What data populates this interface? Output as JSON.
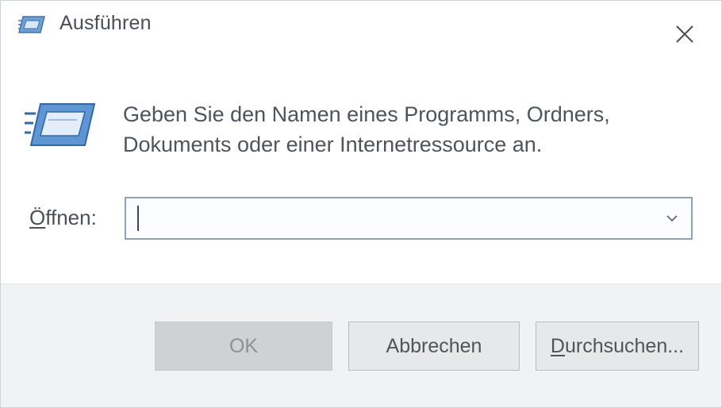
{
  "dialog": {
    "title": "Ausführen",
    "close_label": "✕",
    "description_line1": "Geben Sie den Namen eines Programms, Ordners,",
    "description_line2": "Dokuments oder einer Internetressource an.",
    "open_label_mnemonic": "Ö",
    "open_label_rest": "ffnen:",
    "open_input_value": "",
    "buttons": {
      "ok": "OK",
      "cancel": "Abbrechen",
      "browse_mnemonic": "D",
      "browse_rest": "urchsuchen..."
    }
  },
  "icons": {
    "title": "run-icon",
    "main": "run-icon",
    "close": "close-icon",
    "dropdown": "chevron-down-icon"
  },
  "colors": {
    "accent": "#4f8fcf",
    "footer_bg": "#f0f2f3",
    "input_border": "#8fa2b3",
    "ok_disabled_bg": "#cfd2d5"
  }
}
